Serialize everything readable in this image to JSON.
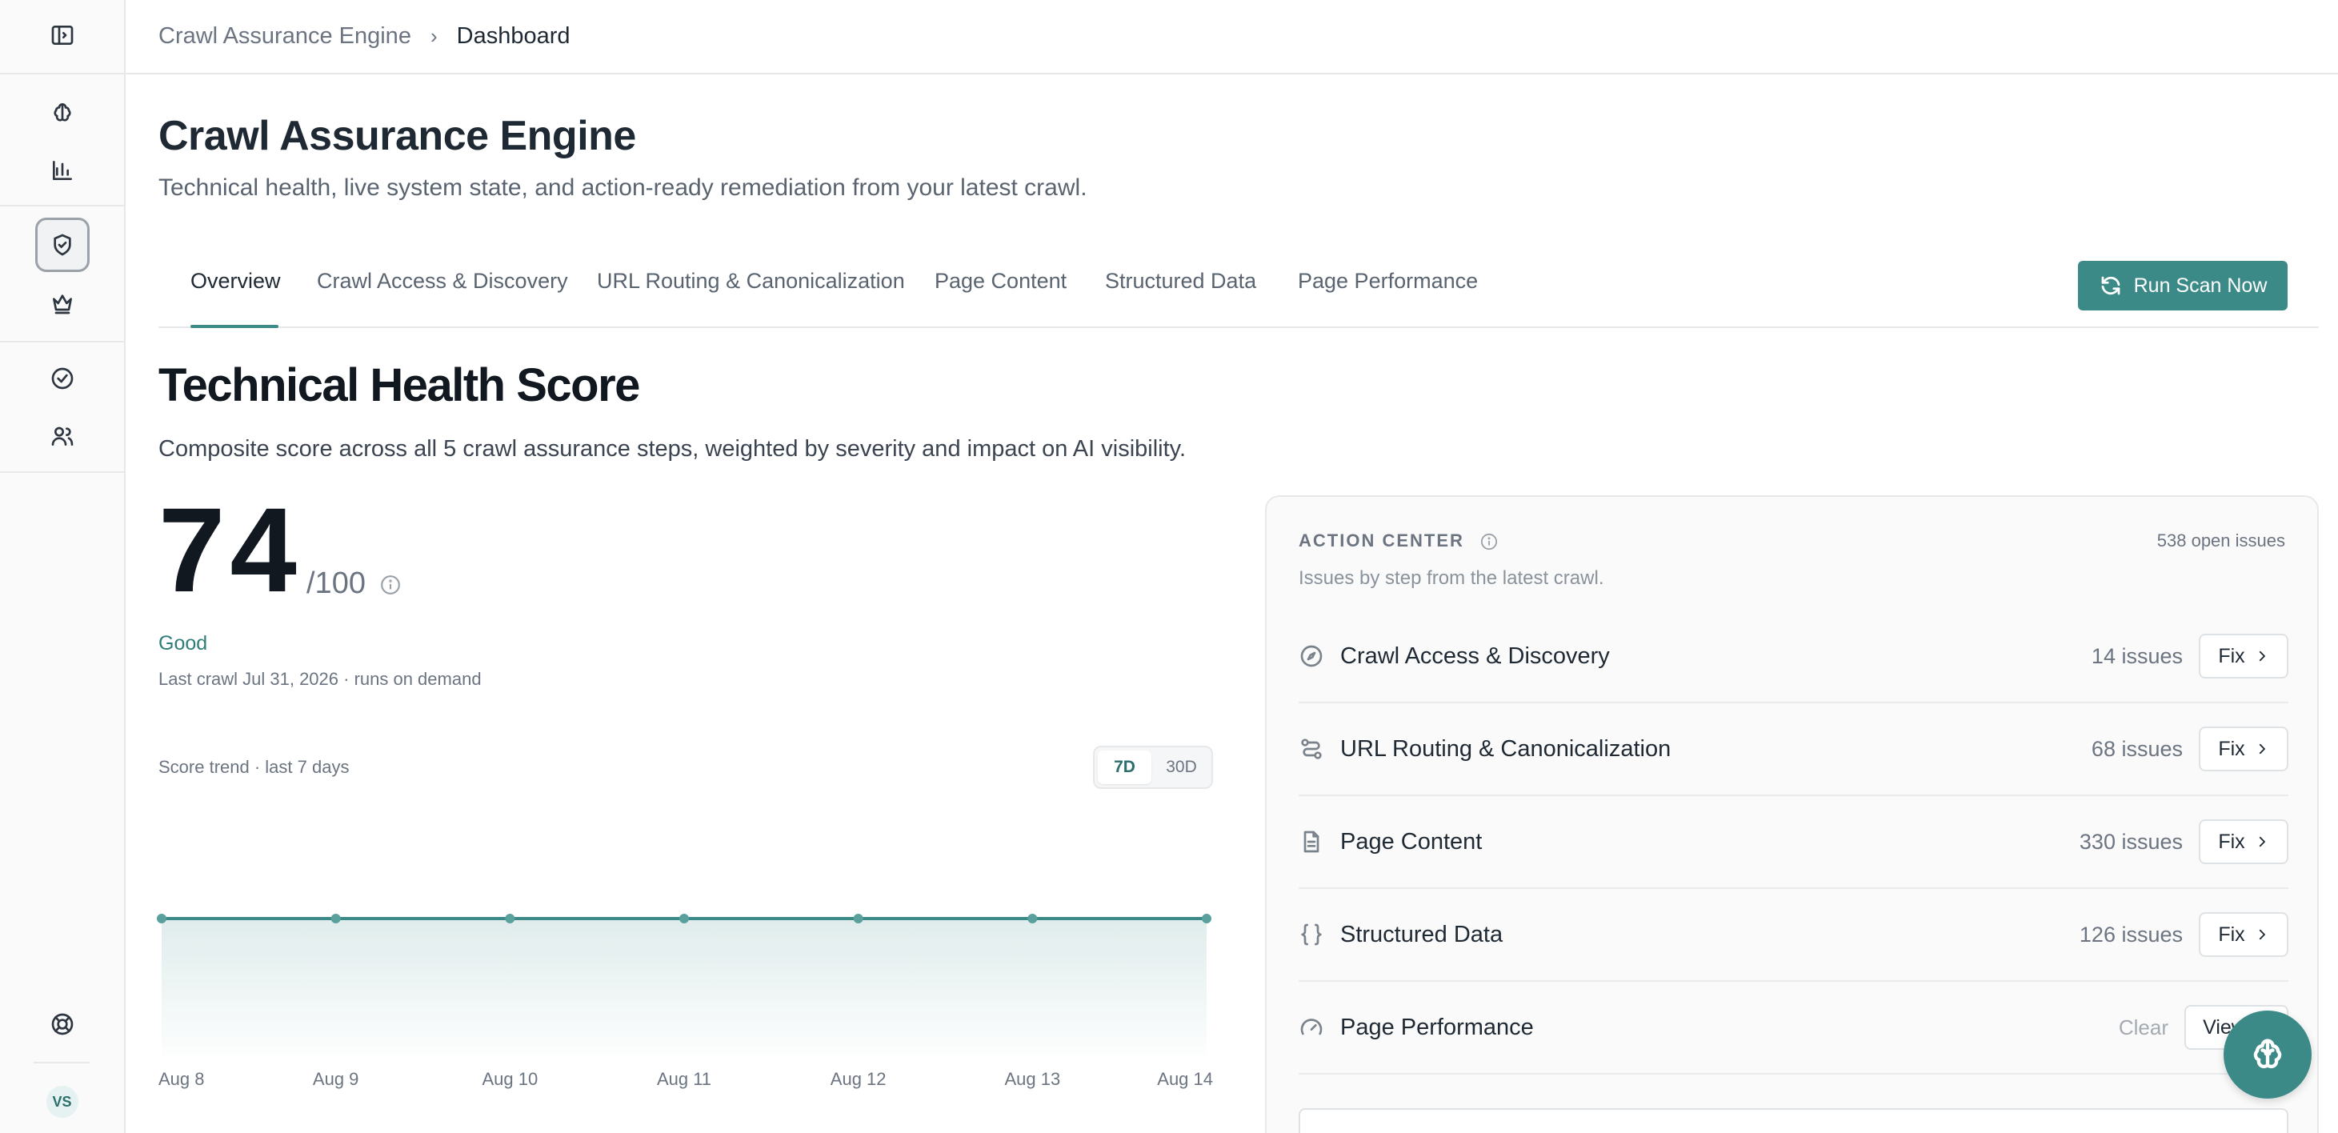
{
  "breadcrumb": {
    "root": "Crawl Assurance Engine",
    "current": "Dashboard"
  },
  "header": {
    "title": "Crawl Assurance Engine",
    "subtitle": "Technical health, live system state, and action-ready remediation from your latest crawl."
  },
  "tabs": [
    {
      "label": "Overview",
      "active": true
    },
    {
      "label": "Crawl Access & Discovery"
    },
    {
      "label": "URL Routing & Canonicalization"
    },
    {
      "label": "Page Content"
    },
    {
      "label": "Structured Data"
    },
    {
      "label": "Page Performance"
    }
  ],
  "run_scan_label": "Run Scan Now",
  "health": {
    "title": "Technical Health Score",
    "subtitle": "Composite score across all 5 crawl assurance steps, weighted by severity and impact on AI visibility.",
    "score": "74",
    "score_max": "/100",
    "status": "Good",
    "last_crawl": "Last crawl Jul 31, 2026 · runs on demand",
    "trend_label": "Score trend · last 7 days",
    "range_options": [
      "7D",
      "30D"
    ],
    "range_selected": "7D"
  },
  "chart_data": {
    "type": "area",
    "x": [
      "Aug 8",
      "Aug 9",
      "Aug 10",
      "Aug 11",
      "Aug 12",
      "Aug 13",
      "Aug 14"
    ],
    "values": [
      74,
      74,
      74,
      74,
      74,
      74,
      74
    ],
    "title": "Score trend · last 7 days",
    "xlabel": "",
    "ylabel": "",
    "ylim": [
      0,
      100
    ],
    "grid": false
  },
  "action_center": {
    "title": "ACTION CENTER",
    "open_issues": "538 open issues",
    "subtitle": "Issues by step from the latest crawl.",
    "rows": [
      {
        "icon": "compass-icon",
        "name": "Crawl Access & Discovery",
        "issues": "14 issues",
        "action": "Fix"
      },
      {
        "icon": "route-icon",
        "name": "URL Routing & Canonicalization",
        "issues": "68 issues",
        "action": "Fix"
      },
      {
        "icon": "document-icon",
        "name": "Page Content",
        "issues": "330 issues",
        "action": "Fix"
      },
      {
        "icon": "braces-icon",
        "name": "Structured Data",
        "issues": "126 issues",
        "action": "Fix"
      },
      {
        "icon": "gauge-icon",
        "name": "Page Performance",
        "issues": "Clear",
        "action": "View"
      }
    ]
  },
  "user": {
    "initials": "VS"
  },
  "colors": {
    "accent": "#3b8a87",
    "status_good": "#2f7d79"
  }
}
